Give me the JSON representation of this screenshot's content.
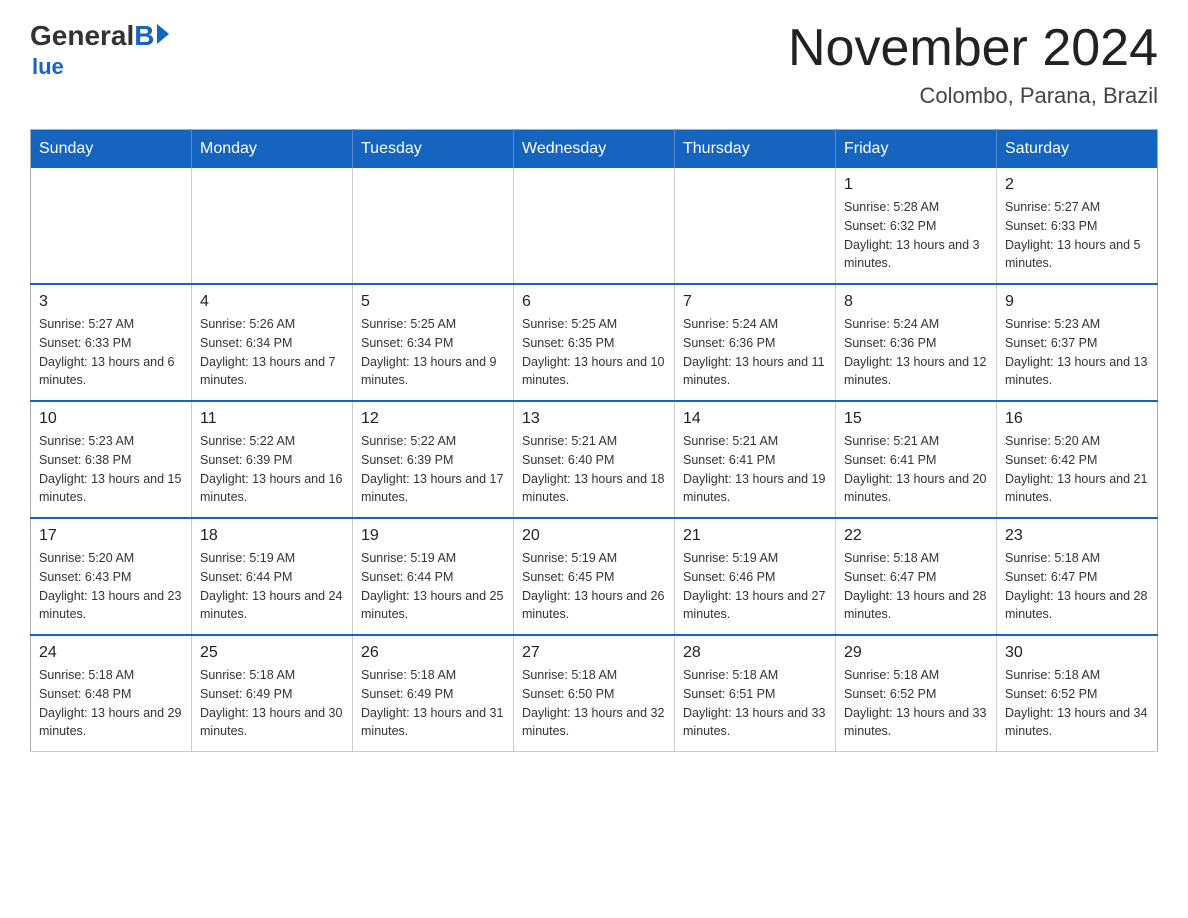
{
  "header": {
    "logo_general": "General",
    "logo_b": "B",
    "logo_blue": "lue",
    "month_title": "November 2024",
    "location": "Colombo, Parana, Brazil"
  },
  "days_of_week": [
    "Sunday",
    "Monday",
    "Tuesday",
    "Wednesday",
    "Thursday",
    "Friday",
    "Saturday"
  ],
  "weeks": [
    [
      {
        "day": "",
        "info": ""
      },
      {
        "day": "",
        "info": ""
      },
      {
        "day": "",
        "info": ""
      },
      {
        "day": "",
        "info": ""
      },
      {
        "day": "",
        "info": ""
      },
      {
        "day": "1",
        "info": "Sunrise: 5:28 AM\nSunset: 6:32 PM\nDaylight: 13 hours and 3 minutes."
      },
      {
        "day": "2",
        "info": "Sunrise: 5:27 AM\nSunset: 6:33 PM\nDaylight: 13 hours and 5 minutes."
      }
    ],
    [
      {
        "day": "3",
        "info": "Sunrise: 5:27 AM\nSunset: 6:33 PM\nDaylight: 13 hours and 6 minutes."
      },
      {
        "day": "4",
        "info": "Sunrise: 5:26 AM\nSunset: 6:34 PM\nDaylight: 13 hours and 7 minutes."
      },
      {
        "day": "5",
        "info": "Sunrise: 5:25 AM\nSunset: 6:34 PM\nDaylight: 13 hours and 9 minutes."
      },
      {
        "day": "6",
        "info": "Sunrise: 5:25 AM\nSunset: 6:35 PM\nDaylight: 13 hours and 10 minutes."
      },
      {
        "day": "7",
        "info": "Sunrise: 5:24 AM\nSunset: 6:36 PM\nDaylight: 13 hours and 11 minutes."
      },
      {
        "day": "8",
        "info": "Sunrise: 5:24 AM\nSunset: 6:36 PM\nDaylight: 13 hours and 12 minutes."
      },
      {
        "day": "9",
        "info": "Sunrise: 5:23 AM\nSunset: 6:37 PM\nDaylight: 13 hours and 13 minutes."
      }
    ],
    [
      {
        "day": "10",
        "info": "Sunrise: 5:23 AM\nSunset: 6:38 PM\nDaylight: 13 hours and 15 minutes."
      },
      {
        "day": "11",
        "info": "Sunrise: 5:22 AM\nSunset: 6:39 PM\nDaylight: 13 hours and 16 minutes."
      },
      {
        "day": "12",
        "info": "Sunrise: 5:22 AM\nSunset: 6:39 PM\nDaylight: 13 hours and 17 minutes."
      },
      {
        "day": "13",
        "info": "Sunrise: 5:21 AM\nSunset: 6:40 PM\nDaylight: 13 hours and 18 minutes."
      },
      {
        "day": "14",
        "info": "Sunrise: 5:21 AM\nSunset: 6:41 PM\nDaylight: 13 hours and 19 minutes."
      },
      {
        "day": "15",
        "info": "Sunrise: 5:21 AM\nSunset: 6:41 PM\nDaylight: 13 hours and 20 minutes."
      },
      {
        "day": "16",
        "info": "Sunrise: 5:20 AM\nSunset: 6:42 PM\nDaylight: 13 hours and 21 minutes."
      }
    ],
    [
      {
        "day": "17",
        "info": "Sunrise: 5:20 AM\nSunset: 6:43 PM\nDaylight: 13 hours and 23 minutes."
      },
      {
        "day": "18",
        "info": "Sunrise: 5:19 AM\nSunset: 6:44 PM\nDaylight: 13 hours and 24 minutes."
      },
      {
        "day": "19",
        "info": "Sunrise: 5:19 AM\nSunset: 6:44 PM\nDaylight: 13 hours and 25 minutes."
      },
      {
        "day": "20",
        "info": "Sunrise: 5:19 AM\nSunset: 6:45 PM\nDaylight: 13 hours and 26 minutes."
      },
      {
        "day": "21",
        "info": "Sunrise: 5:19 AM\nSunset: 6:46 PM\nDaylight: 13 hours and 27 minutes."
      },
      {
        "day": "22",
        "info": "Sunrise: 5:18 AM\nSunset: 6:47 PM\nDaylight: 13 hours and 28 minutes."
      },
      {
        "day": "23",
        "info": "Sunrise: 5:18 AM\nSunset: 6:47 PM\nDaylight: 13 hours and 28 minutes."
      }
    ],
    [
      {
        "day": "24",
        "info": "Sunrise: 5:18 AM\nSunset: 6:48 PM\nDaylight: 13 hours and 29 minutes."
      },
      {
        "day": "25",
        "info": "Sunrise: 5:18 AM\nSunset: 6:49 PM\nDaylight: 13 hours and 30 minutes."
      },
      {
        "day": "26",
        "info": "Sunrise: 5:18 AM\nSunset: 6:49 PM\nDaylight: 13 hours and 31 minutes."
      },
      {
        "day": "27",
        "info": "Sunrise: 5:18 AM\nSunset: 6:50 PM\nDaylight: 13 hours and 32 minutes."
      },
      {
        "day": "28",
        "info": "Sunrise: 5:18 AM\nSunset: 6:51 PM\nDaylight: 13 hours and 33 minutes."
      },
      {
        "day": "29",
        "info": "Sunrise: 5:18 AM\nSunset: 6:52 PM\nDaylight: 13 hours and 33 minutes."
      },
      {
        "day": "30",
        "info": "Sunrise: 5:18 AM\nSunset: 6:52 PM\nDaylight: 13 hours and 34 minutes."
      }
    ]
  ],
  "accent_color": "#1565c0"
}
